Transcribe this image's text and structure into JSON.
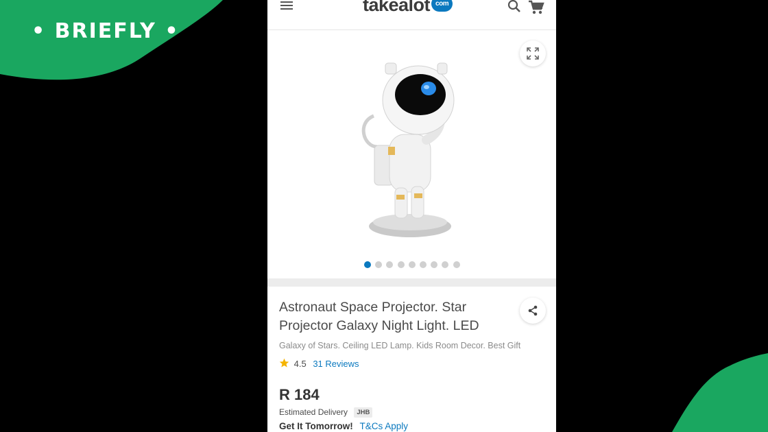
{
  "overlay": {
    "brand": "BRIEFLY",
    "brand_color": "#1aa760"
  },
  "header": {
    "logo_text": "takealot",
    "logo_badge": "com",
    "menu_icon": "hamburger-menu-icon",
    "search_icon": "search-icon",
    "cart_icon": "cart-icon"
  },
  "gallery": {
    "image": "astronaut-projector-image",
    "expand_icon": "expand-icon",
    "dot_count": 9,
    "active_dot": 1
  },
  "product": {
    "title": "Astronaut Space Projector. Star Projector Galaxy Night Light. LED",
    "subtitle": "Galaxy of Stars. Ceiling LED Lamp. Kids Room Decor. Best Gift",
    "rating": "4.5",
    "reviews": "31 Reviews",
    "price": "R 184",
    "delivery_label": "Estimated Delivery",
    "delivery_badge": "JHB",
    "delivery_promise": "Get It Tomorrow!",
    "terms_link": "T&Cs Apply",
    "share_icon": "share-icon"
  },
  "colors": {
    "accent": "#0b79bf",
    "star": "#f5b400"
  }
}
